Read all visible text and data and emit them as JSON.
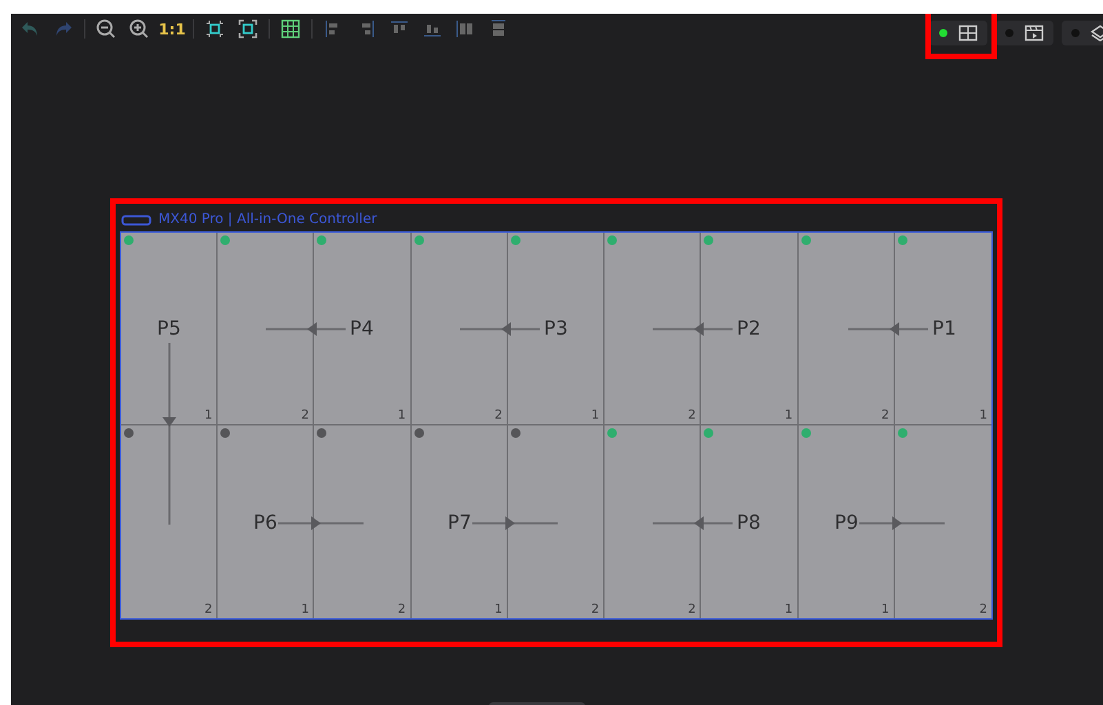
{
  "toolbar": {
    "undo": {
      "disabled": true
    },
    "redo": {
      "disabled": true
    },
    "actual_size": "1:1",
    "grid": {
      "on": true
    }
  },
  "view_buttons": [
    {
      "kind": "layout",
      "on": true
    },
    {
      "kind": "video",
      "on": false
    },
    {
      "kind": "layers",
      "on": false
    }
  ],
  "canvas": {
    "title": "MX40 Pro | All-in-One Controller",
    "rows": [
      [
        {
          "number": "1",
          "color": "#2fae6e"
        },
        {
          "number": "2",
          "color": "#2fae6e"
        },
        {
          "number": "1",
          "color": "#2fae6e"
        },
        {
          "number": "2",
          "color": "#2fae6e"
        },
        {
          "number": "1",
          "color": "#2fae6e"
        },
        {
          "number": "2",
          "color": "#2fae6e"
        },
        {
          "number": "1",
          "color": "#2fae6e"
        },
        {
          "number": "2",
          "color": "#2fae6e"
        },
        {
          "number": "1",
          "color": "#2fae6e"
        }
      ],
      [
        {
          "number": "2",
          "color": "#555558"
        },
        {
          "number": "1",
          "color": "#555558"
        },
        {
          "number": "2",
          "color": "#555558"
        },
        {
          "number": "1",
          "color": "#555558"
        },
        {
          "number": "2",
          "color": "#555558"
        },
        {
          "number": "2",
          "color": "#2fae6e"
        },
        {
          "number": "1",
          "color": "#2fae6e"
        },
        {
          "number": "1",
          "color": "#2fae6e"
        },
        {
          "number": "2",
          "color": "#2fae6e"
        }
      ]
    ],
    "ports": [
      {
        "label": "P5",
        "kind": "down"
      },
      {
        "label": "P4",
        "kind": "left"
      },
      {
        "label": "P3",
        "kind": "left"
      },
      {
        "label": "P2",
        "kind": "left"
      },
      {
        "label": "P1",
        "kind": "left"
      },
      {
        "label": "P6",
        "kind": "right"
      },
      {
        "label": "P7",
        "kind": "right"
      },
      {
        "label": "P8",
        "kind": "left"
      },
      {
        "label": "P9",
        "kind": "right"
      }
    ]
  }
}
